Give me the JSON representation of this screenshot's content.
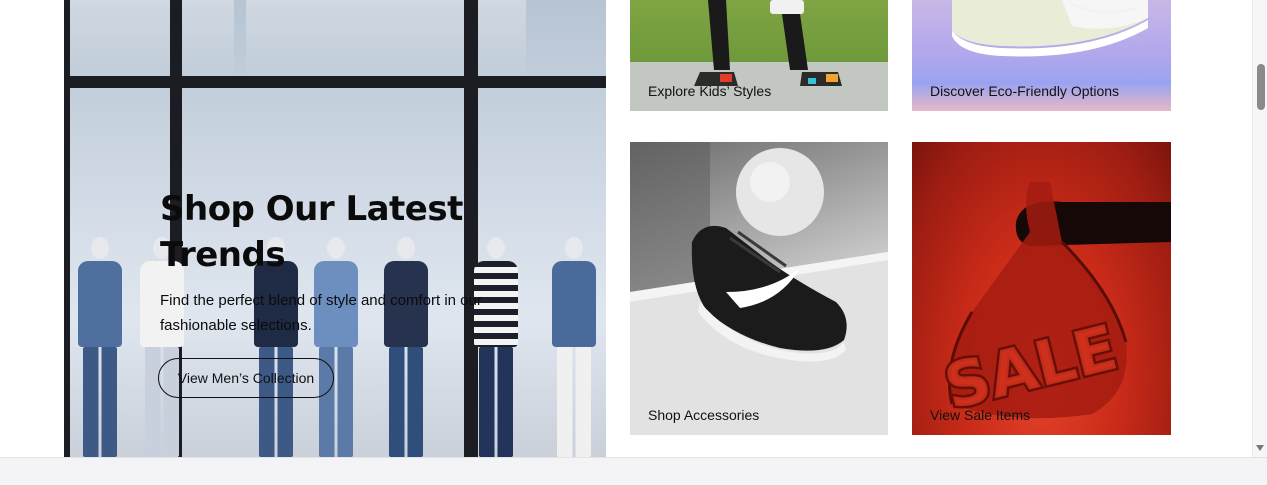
{
  "hero": {
    "title": "Shop Our Latest Trends",
    "subtitle": "Find the perfect blend of style and comfort in our fashionable selections.",
    "button_label": "View Men’s Collection"
  },
  "tiles": [
    {
      "label": "Explore Kids’ Styles",
      "icon": "kids-sneakers-image"
    },
    {
      "label": "Discover Eco-Friendly Options",
      "icon": "eco-sneaker-image"
    },
    {
      "label": "Shop Accessories",
      "icon": "black-sneaker-image"
    },
    {
      "label": "View Sale Items",
      "icon": "sale-bag-image"
    }
  ],
  "colors": {
    "text": "#111111",
    "sale_red": "#c82a18",
    "scroll_thumb": "#8a8a8a"
  }
}
